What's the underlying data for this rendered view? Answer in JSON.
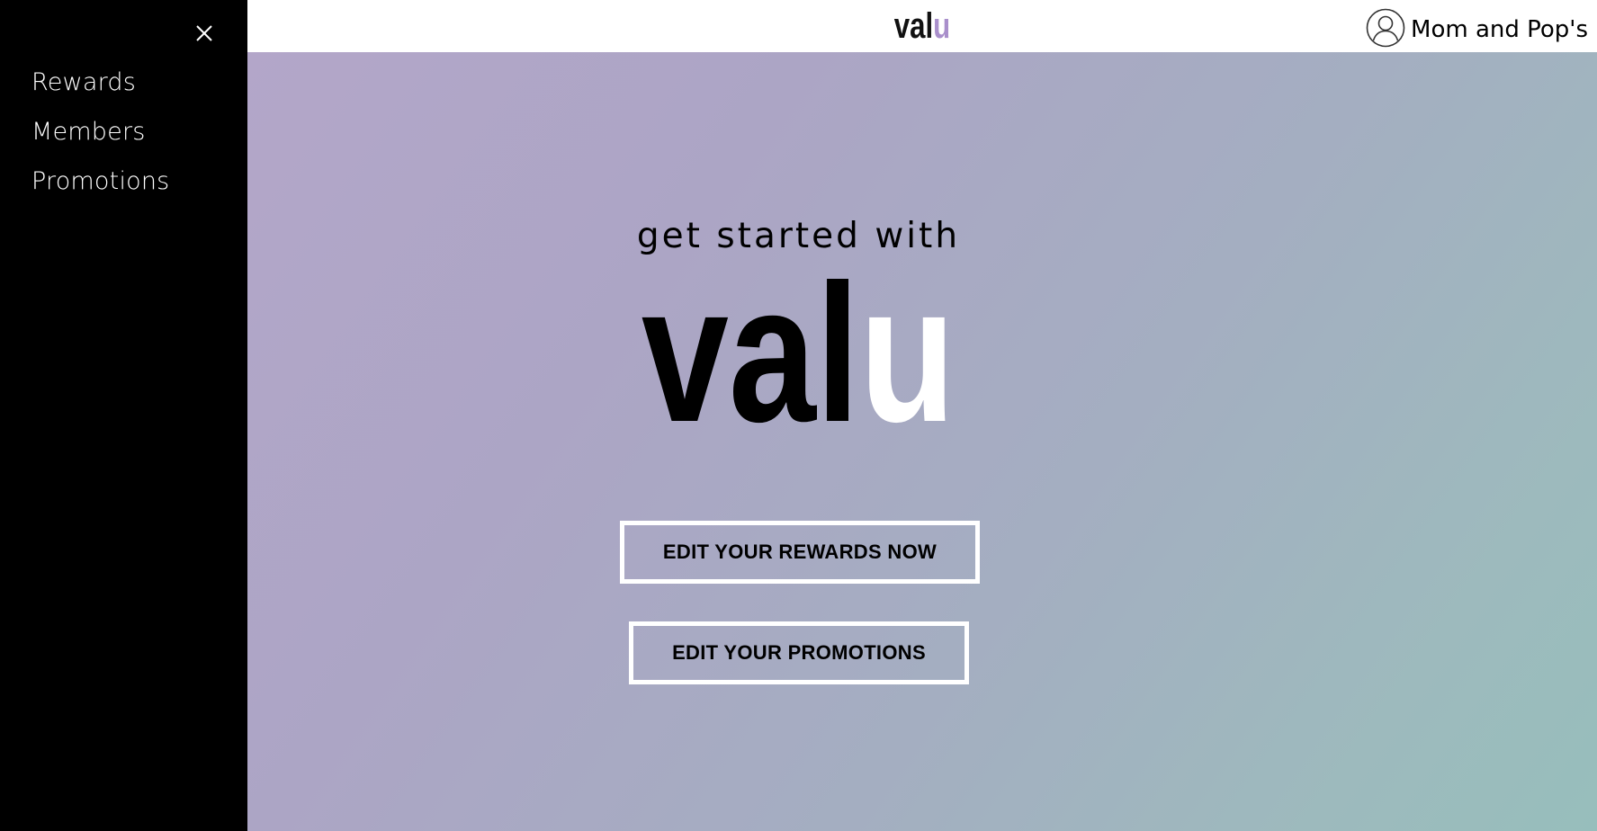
{
  "sidebar": {
    "close_icon": "close-icon",
    "items": [
      {
        "label": "Rewards"
      },
      {
        "label": "Members"
      },
      {
        "label": "Promotions"
      }
    ]
  },
  "header": {
    "logo": {
      "part1": "val",
      "part2": "u"
    },
    "account": {
      "icon": "user-circle-icon",
      "name": "Mom and Pop's"
    }
  },
  "hero": {
    "tagline": "get started with",
    "logo": {
      "part1": "val",
      "part2": "u"
    },
    "buttons": {
      "rewards": "EDIT YOUR REWARDS NOW",
      "promotions": "EDIT YOUR PROMOTIONS"
    }
  },
  "colors": {
    "sidebar_bg": "#000000",
    "logo_accent": "#a98fcb",
    "gradient_start": "#b3a6c9",
    "gradient_end": "#97bebc",
    "button_border": "#ffffff"
  }
}
